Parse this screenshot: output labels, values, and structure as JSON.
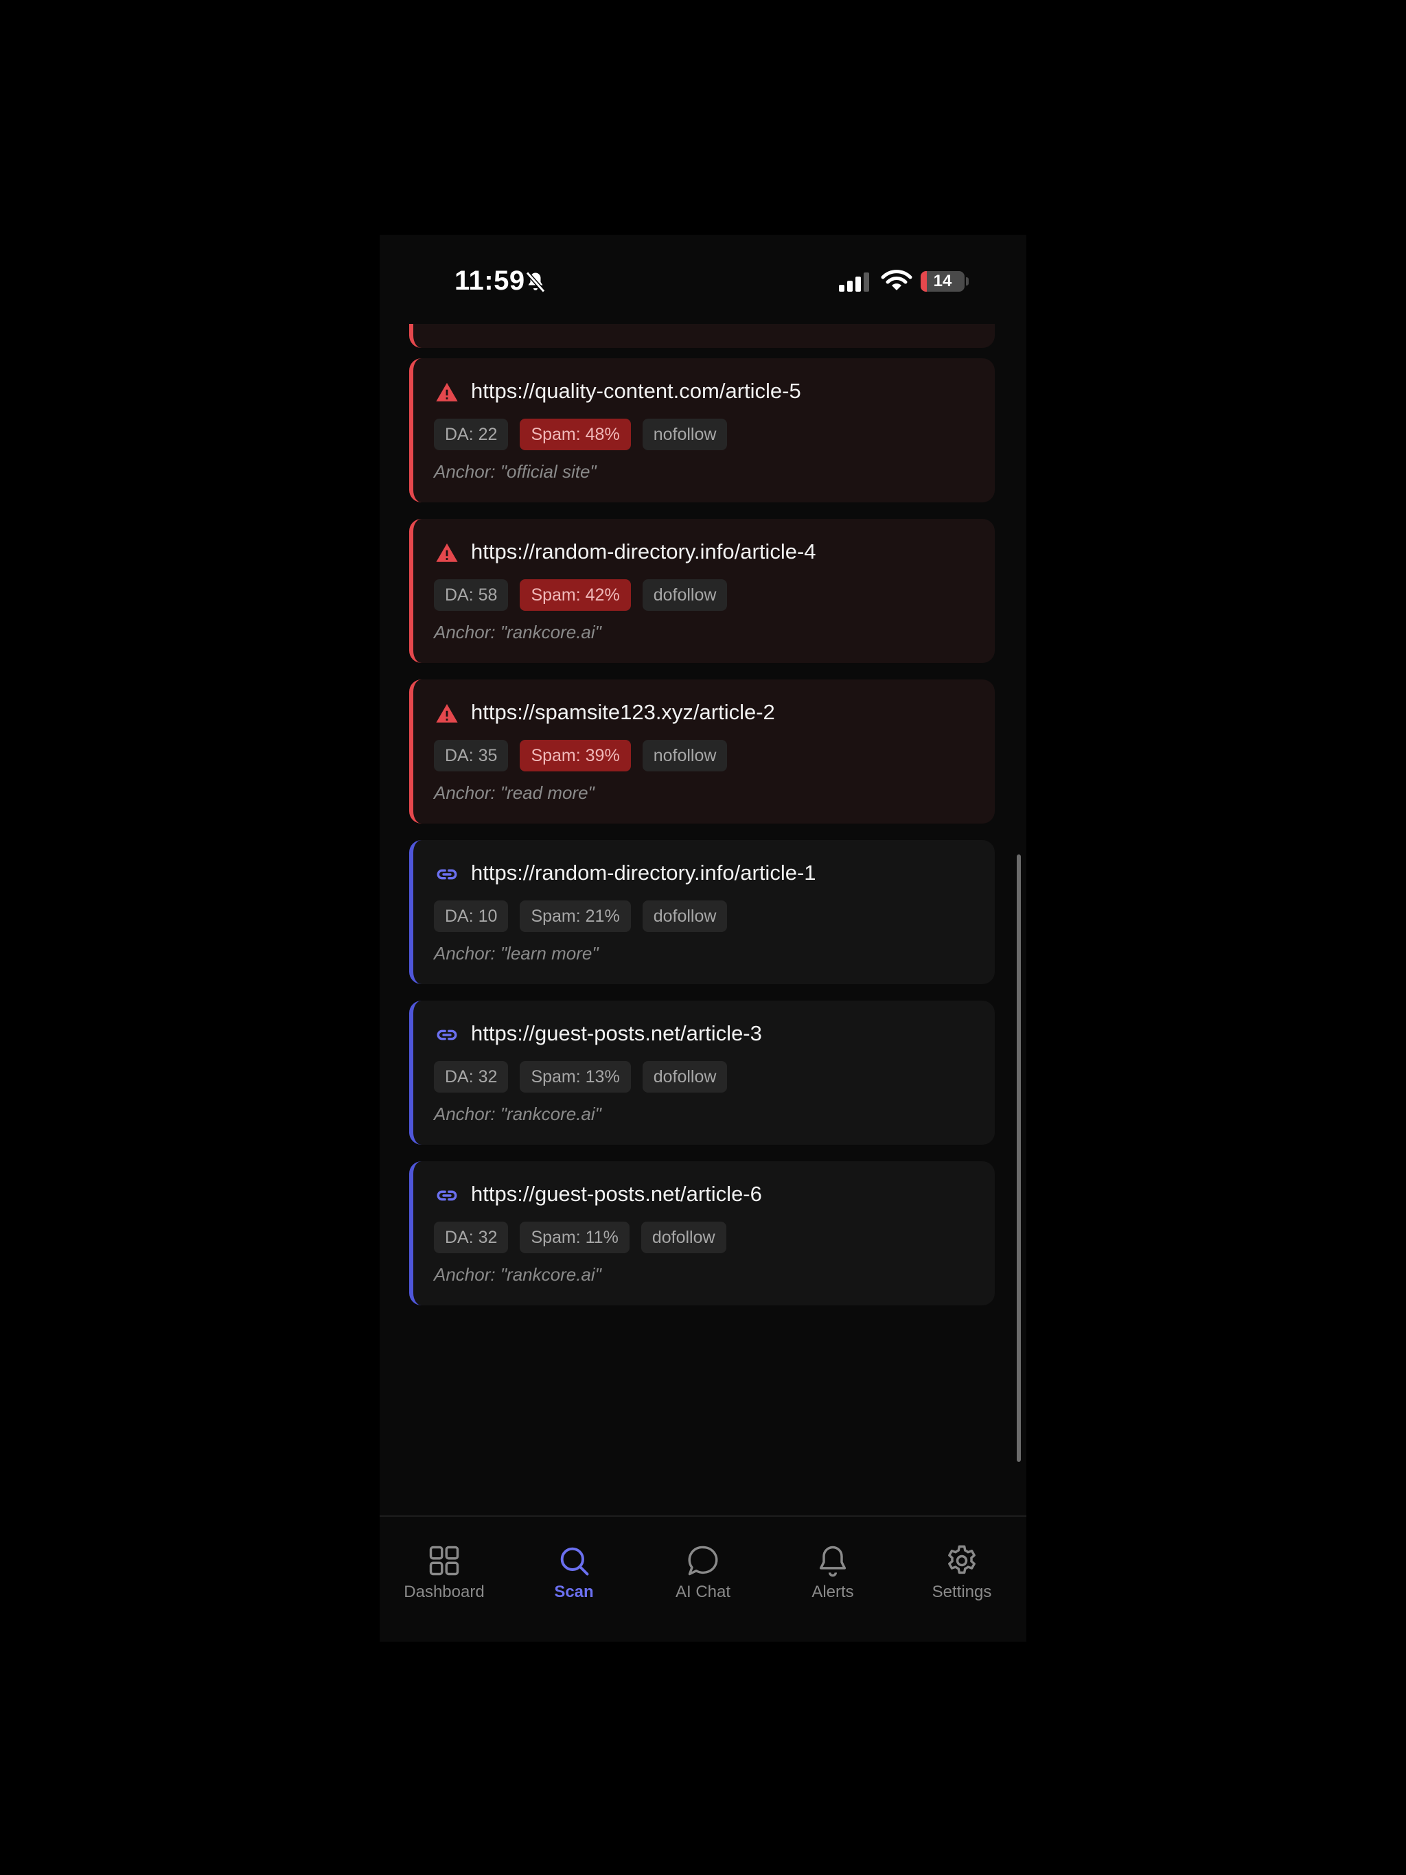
{
  "status_bar": {
    "time": "11:59",
    "battery": "14",
    "battery_level_percent": 14,
    "icons": [
      "bell-slash-icon",
      "cellular-signal-icon",
      "wifi-icon",
      "battery-icon"
    ]
  },
  "colors": {
    "accent": "#6b70f0",
    "danger": "#e5484d",
    "spam_chip": "#8f1d1d"
  },
  "backlinks": [
    {
      "url": "https://quality-content.com/article-5",
      "status": "spam",
      "icon": "warning-triangle-icon",
      "da": "DA: 22",
      "spam": "Spam: 48%",
      "rel": "nofollow",
      "anchor": "Anchor: \"official site\""
    },
    {
      "url": "https://random-directory.info/article-4",
      "status": "spam",
      "icon": "warning-triangle-icon",
      "da": "DA: 58",
      "spam": "Spam: 42%",
      "rel": "dofollow",
      "anchor": "Anchor: \"rankcore.ai\""
    },
    {
      "url": "https://spamsite123.xyz/article-2",
      "status": "spam",
      "icon": "warning-triangle-icon",
      "da": "DA: 35",
      "spam": "Spam: 39%",
      "rel": "nofollow",
      "anchor": "Anchor: \"read more\""
    },
    {
      "url": "https://random-directory.info/article-1",
      "status": "ok",
      "icon": "link-icon",
      "da": "DA: 10",
      "spam": "Spam: 21%",
      "rel": "dofollow",
      "anchor": "Anchor: \"learn more\""
    },
    {
      "url": "https://guest-posts.net/article-3",
      "status": "ok",
      "icon": "link-icon",
      "da": "DA: 32",
      "spam": "Spam: 13%",
      "rel": "dofollow",
      "anchor": "Anchor: \"rankcore.ai\""
    },
    {
      "url": "https://guest-posts.net/article-6",
      "status": "ok",
      "icon": "link-icon",
      "da": "DA: 32",
      "spam": "Spam: 11%",
      "rel": "dofollow",
      "anchor": "Anchor: \"rankcore.ai\""
    }
  ],
  "tabs": [
    {
      "label": "Dashboard",
      "icon": "grid-icon",
      "active": false
    },
    {
      "label": "Scan",
      "icon": "search-icon",
      "active": true
    },
    {
      "label": "AI Chat",
      "icon": "chat-bubble-icon",
      "active": false
    },
    {
      "label": "Alerts",
      "icon": "bell-icon",
      "active": false
    },
    {
      "label": "Settings",
      "icon": "gear-icon",
      "active": false
    }
  ]
}
